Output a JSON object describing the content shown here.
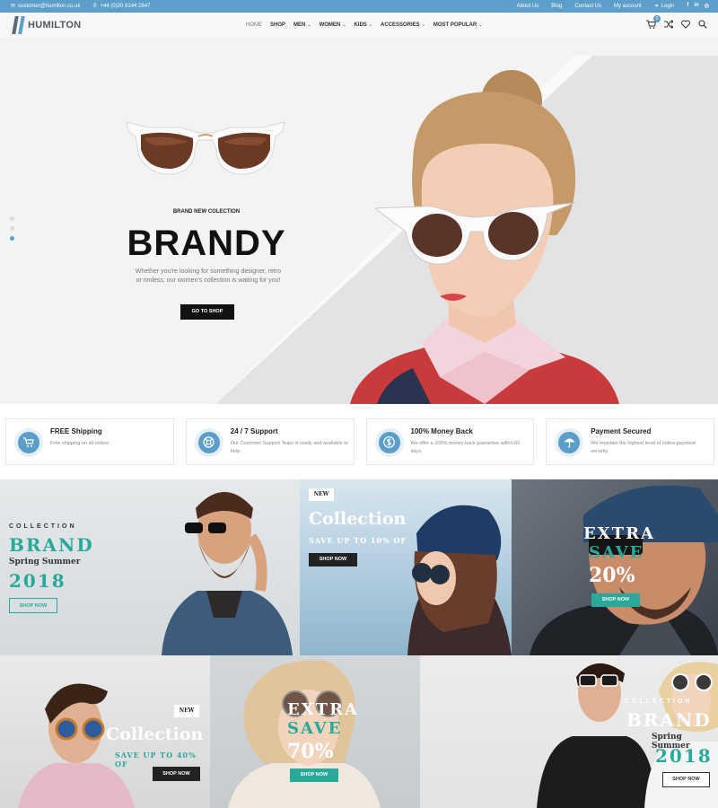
{
  "topbar": {
    "email": "customer@humilton.co.uk",
    "phone": "+44 (0)20 8144 2847",
    "links": [
      "About Us",
      "Blog",
      "Contact Us",
      "My account"
    ],
    "login": "Login",
    "social": [
      "f",
      "in",
      "◎"
    ]
  },
  "header": {
    "logo": "HUMILTON",
    "nav": [
      {
        "label": "HOME"
      },
      {
        "label": "SHOP"
      },
      {
        "label": "MEN"
      },
      {
        "label": "WOMEN"
      },
      {
        "label": "KIDS"
      },
      {
        "label": "ACCESSORIES"
      },
      {
        "label": "MOST POPULAR"
      }
    ],
    "cart_count": "0",
    "icons": [
      "cart-icon",
      "shuffle-icon",
      "heart-icon",
      "search-icon"
    ]
  },
  "hero": {
    "kicker": "BRAND NEW COLECTION",
    "title": "BRANDY",
    "description": "Whether you're looking for something designer, retro or rimless; our women's collection is waiting for you!",
    "button": "GO TO SHOP",
    "slides": 3,
    "active_slide": 3
  },
  "features": [
    {
      "title": "FREE Shipping",
      "desc": "Free shipping on all orders",
      "icon": "cart-icon"
    },
    {
      "title": "24 / 7 Support",
      "desc": "Our Customer Support Team is ready and available to help.",
      "icon": "lifebuoy-icon"
    },
    {
      "title": "100% Money Back",
      "desc": "We offer a 100% money-back guarantee within 60 days.",
      "icon": "dollar-icon"
    },
    {
      "title": "Payment Secured",
      "desc": "We maintain the highest level of online payment security.",
      "icon": "umbrella-icon"
    }
  ],
  "banners": {
    "b1": {
      "kicker": "COLLECTION",
      "title": "BRAND",
      "subtitle": "Spring Summer",
      "year": "2018",
      "button": "SHOP NOW"
    },
    "b2": {
      "tag": "NEW",
      "title": "Collection",
      "subtitle": "SAVE UP TO 10% OF",
      "button": "SHOP NOW"
    },
    "b3": {
      "line1": "EXTRA",
      "line2": "SAVE",
      "percent": "20%",
      "button": "SHOP NOW"
    },
    "b4": {
      "tag": "NEW",
      "title": "Collection",
      "subtitle": "SAVE UP TO 40% OF",
      "button": "SHOP NOW"
    },
    "b5": {
      "line1": "EXTRA",
      "line2": "SAVE",
      "percent": "70%",
      "button": "SHOP NOW"
    },
    "b6": {
      "kicker": "COLLECTION",
      "title": "BRAND",
      "subtitle": "Spring Summer",
      "year": "2018",
      "button": "SHOP NOW"
    }
  },
  "colors": {
    "accent": "#5b9ec9",
    "teal": "#28a99a",
    "dark": "#111111"
  }
}
